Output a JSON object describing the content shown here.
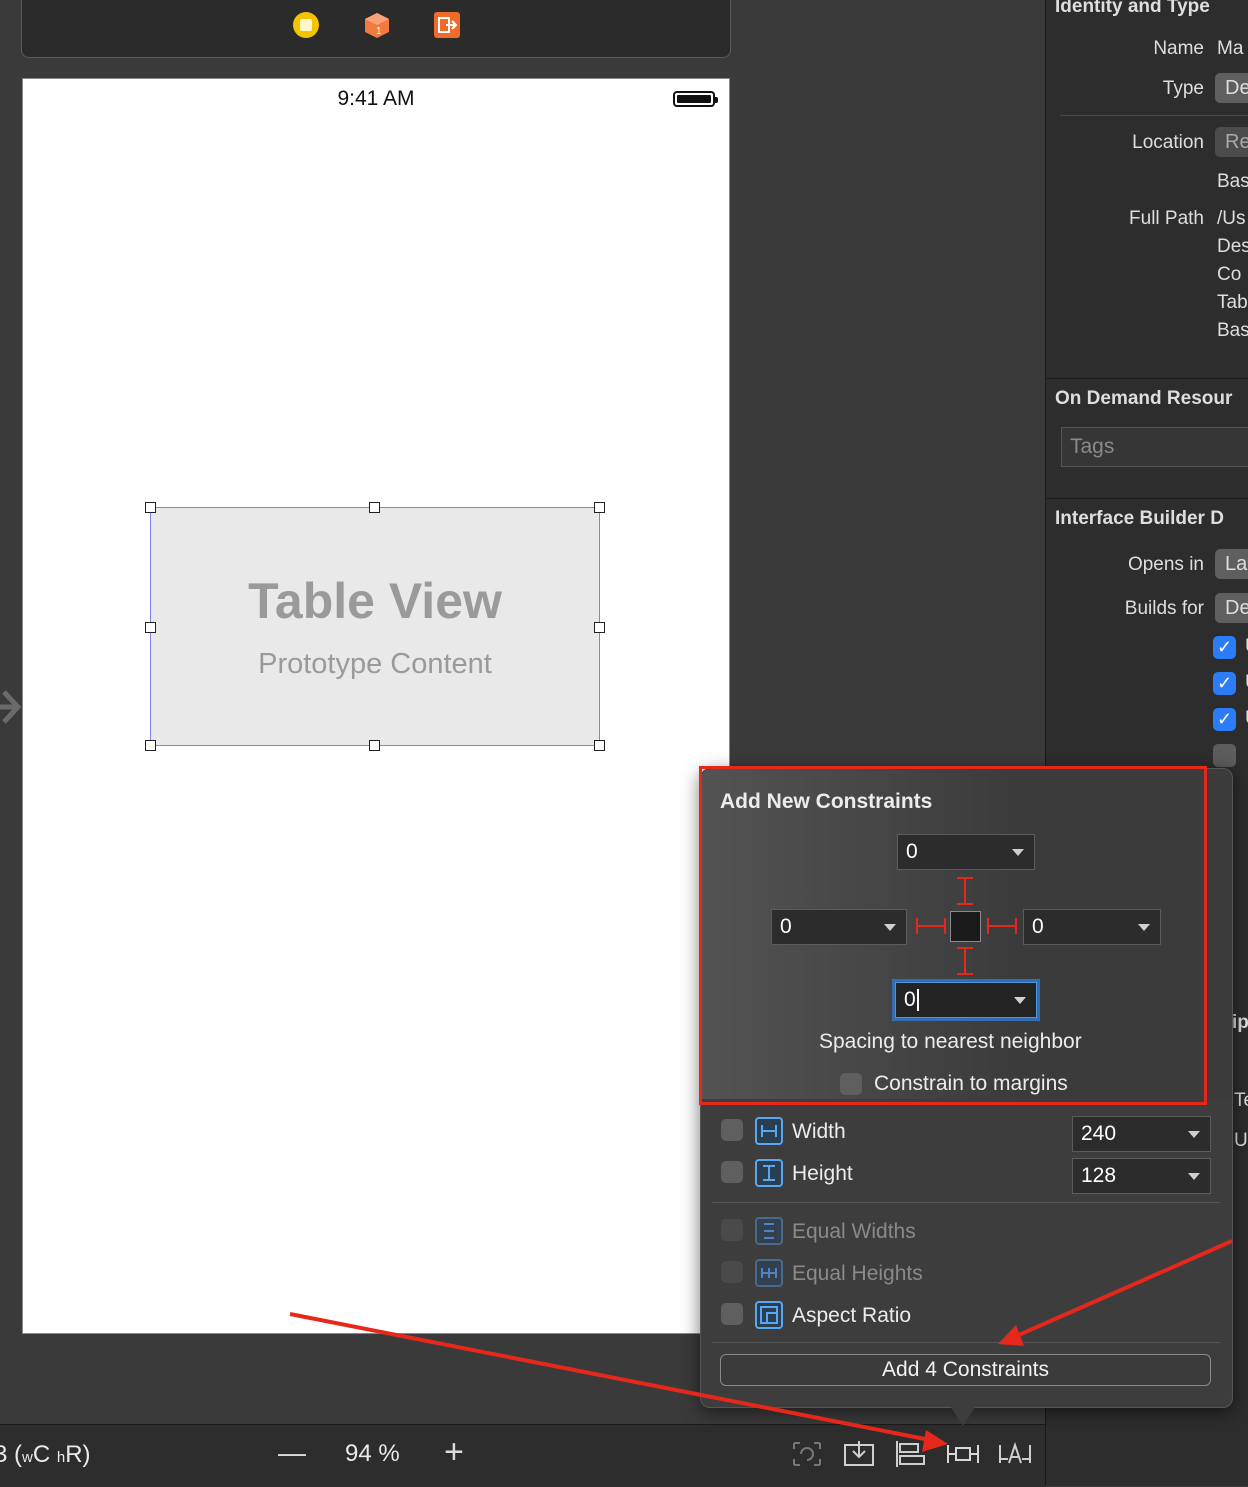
{
  "canvas": {
    "status_time": "9:41 AM",
    "table_view_title": "Table View",
    "table_view_subtitle": "Prototype Content"
  },
  "scene_dock": {
    "icons": [
      "view-controller-icon",
      "first-responder-icon",
      "exit-icon"
    ],
    "colors": {
      "view_controller": "#f5c400",
      "first_responder": "#f07a40",
      "exit": "#f06a2a"
    }
  },
  "bottom_bar": {
    "size_class_prefix": "3 (",
    "size_class_w": "w",
    "size_class_c": "C",
    "size_class_h": "h",
    "size_class_r": "R)",
    "zoom_minus": "—",
    "zoom_level": "94 %",
    "zoom_plus": "+",
    "tools": [
      "update-frames-icon",
      "embed-in-stack-icon",
      "align-icon",
      "add-constraints-icon",
      "resolve-issues-icon"
    ]
  },
  "inspector": {
    "section_identity": "Identity and Type",
    "name_label": "Name",
    "name_value": "Ma",
    "type_label": "Type",
    "type_value": "De",
    "location_label": "Location",
    "location_value": "Re",
    "location_sub": "Bas",
    "full_path_label": "Full Path",
    "full_path_lines": [
      "/Us",
      "Des",
      "Co",
      "Tab",
      "Bas"
    ],
    "section_odr": "On Demand Resour",
    "tags_placeholder": "Tags",
    "section_ib": "Interface Builder D",
    "opens_in_label": "Opens in",
    "opens_in_value": "La",
    "builds_for_label": "Builds for",
    "builds_for_value": "De",
    "checkbox_labels": [
      "U",
      "U",
      "U",
      ""
    ],
    "partial_ip": "ip",
    "partial_te": "Te",
    "partial_u": "U",
    "accent": "#2b7cf6"
  },
  "popover": {
    "title": "Add New Constraints",
    "top_value": "0",
    "left_value": "0",
    "right_value": "0",
    "bottom_value": "0",
    "spacing_label": "Spacing to nearest neighbor",
    "margins_label": "Constrain to margins",
    "width_label": "Width",
    "width_value": "240",
    "height_label": "Height",
    "height_value": "128",
    "equal_widths_label": "Equal Widths",
    "equal_heights_label": "Equal Heights",
    "aspect_ratio_label": "Aspect Ratio",
    "add_button_label": "Add 4 Constraints",
    "highlight_color": "#e6281c"
  }
}
